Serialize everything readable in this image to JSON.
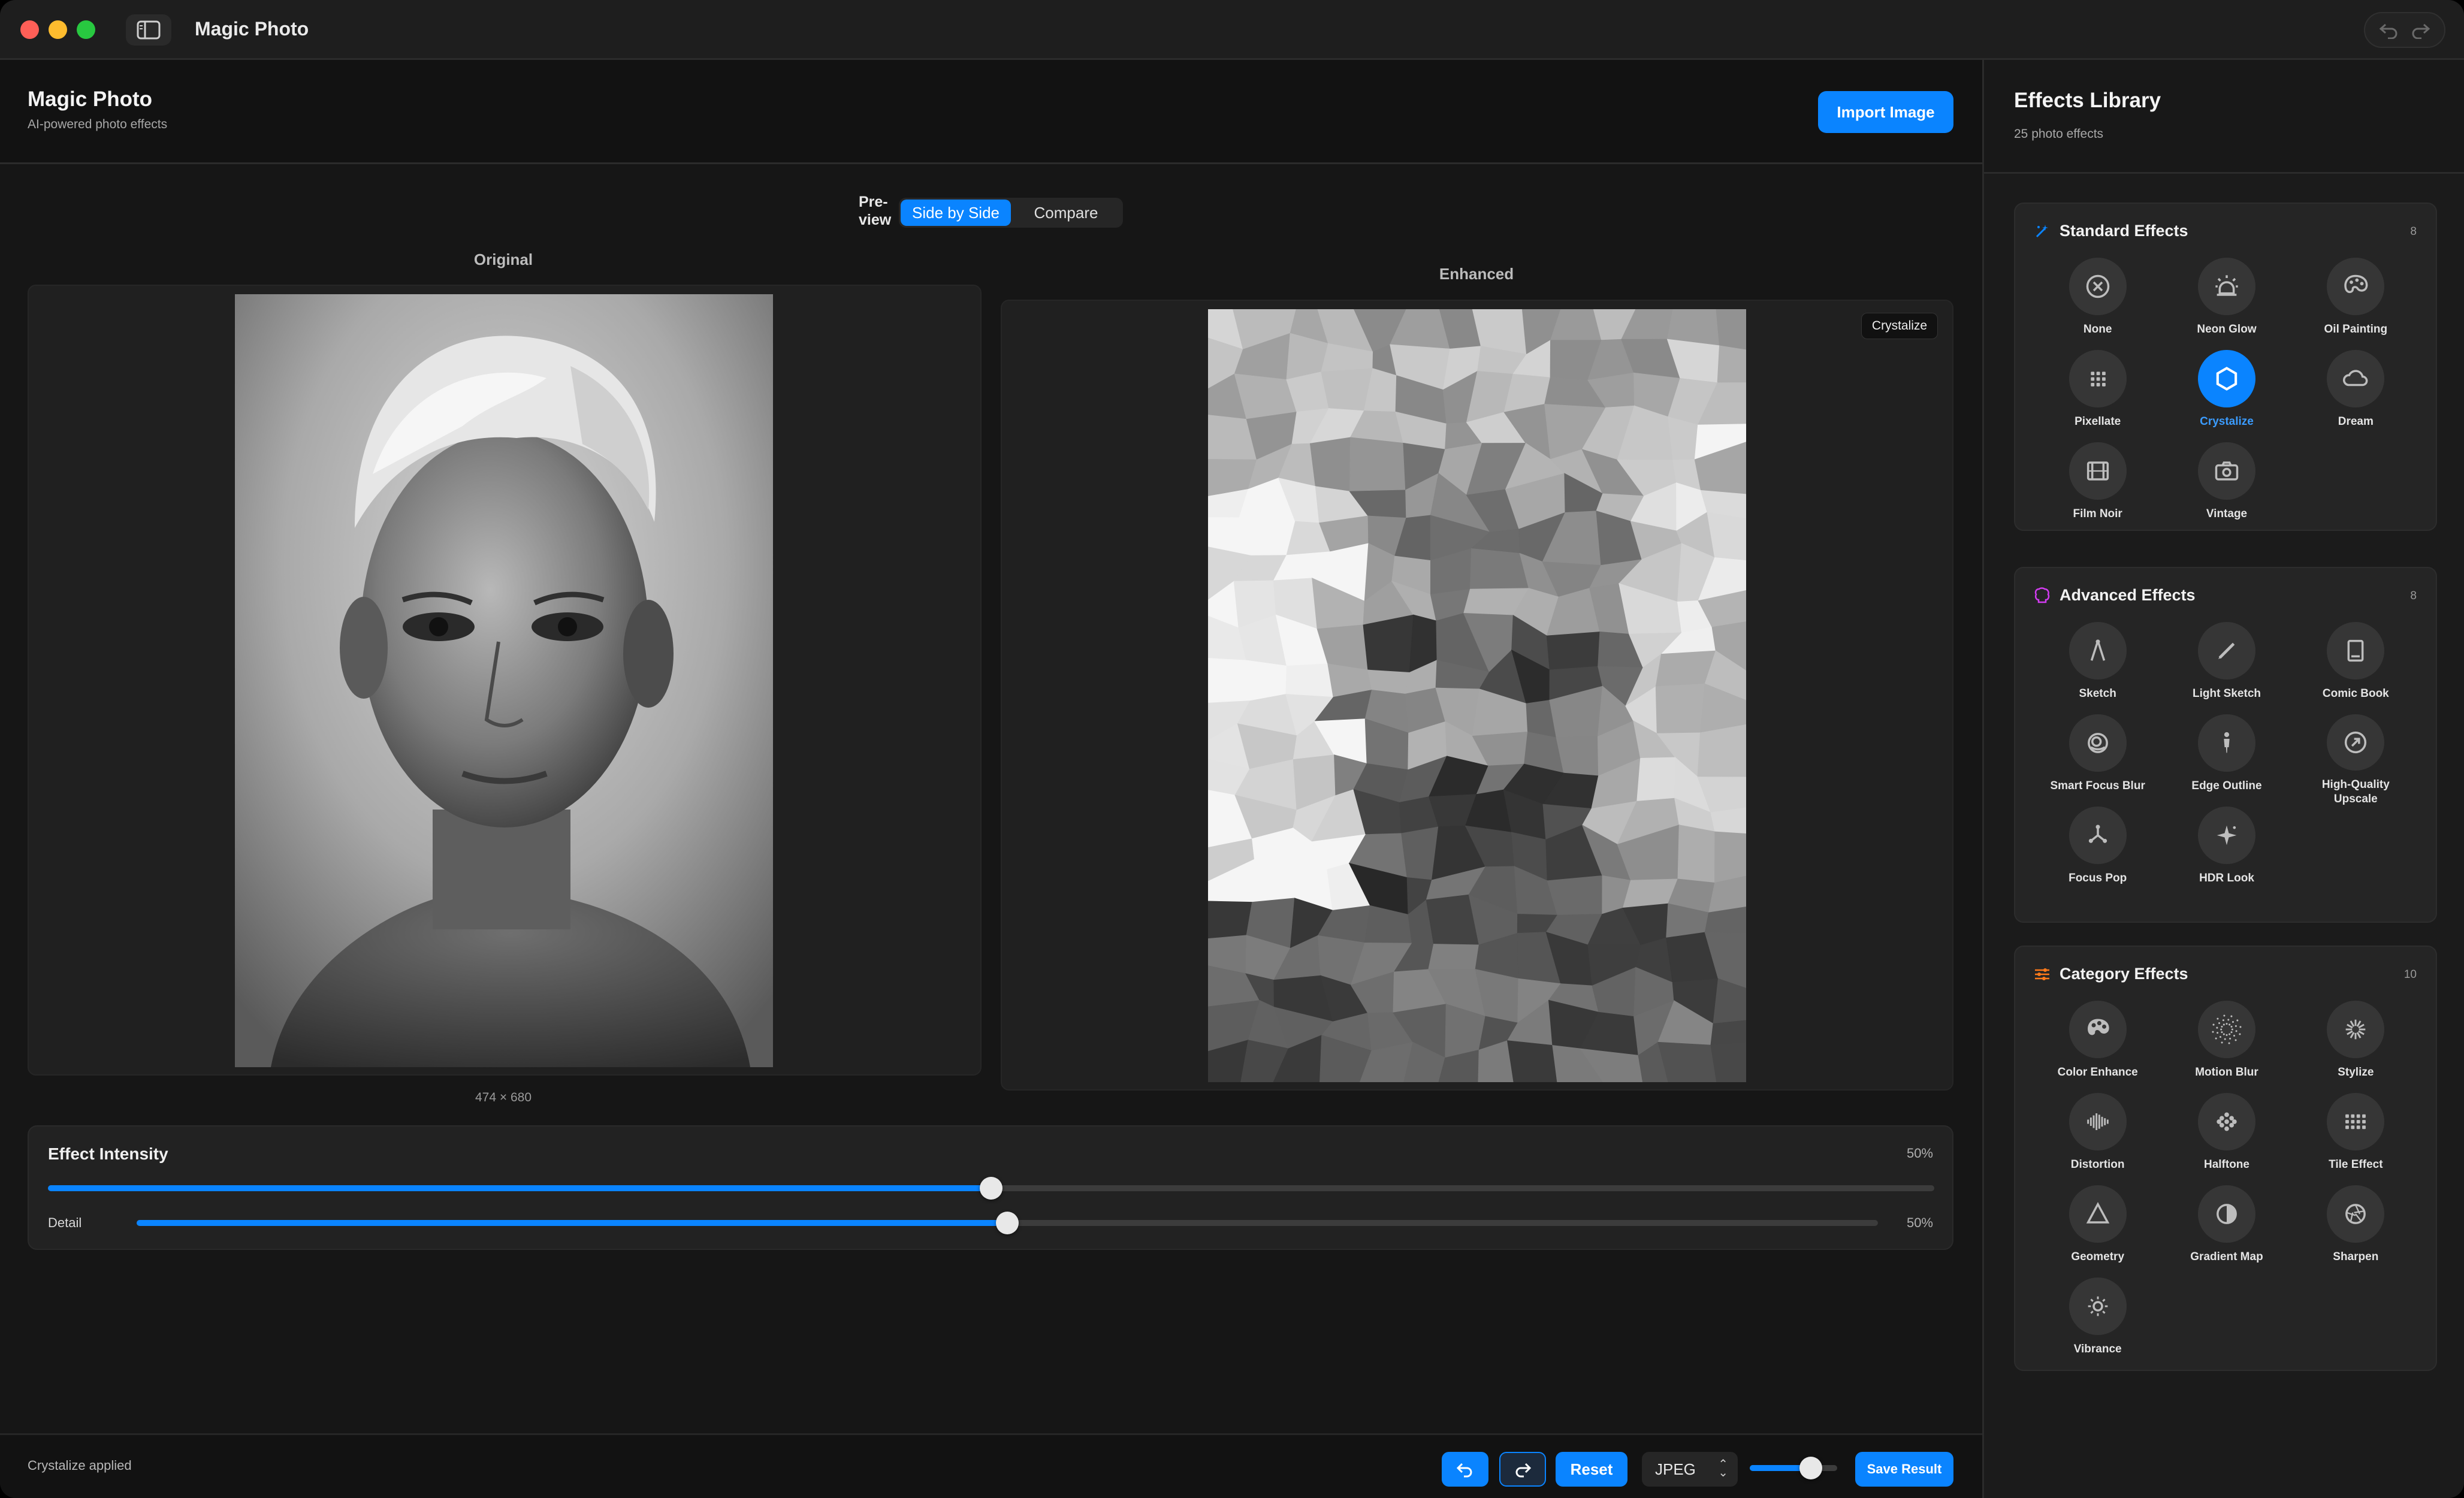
{
  "window": {
    "title": "Magic Photo",
    "traffic_lights": [
      "#ff5f57",
      "#febc2e",
      "#28c840"
    ]
  },
  "header": {
    "title": "Magic Photo",
    "subtitle": "AI-powered photo effects",
    "import_label": "Import Image"
  },
  "preview": {
    "label": "Pre-\nview",
    "modes": [
      "Side by Side",
      "Compare"
    ],
    "active_mode": "Side by Side",
    "original_label": "Original",
    "enhanced_label": "Enhanced",
    "dimensions": "474 × 680",
    "effect_tag": "Crystalize"
  },
  "intensity": {
    "title": "Effect Intensity",
    "value_label": "50%",
    "value": 0.5,
    "detail_label": "Detail",
    "detail_value_label": "50%",
    "detail_value": 0.5
  },
  "footer": {
    "status": "Crystalize applied",
    "reset_label": "Reset",
    "format": "JPEG",
    "quality": 0.7,
    "save_label": "Save Result"
  },
  "library": {
    "title": "Effects Library",
    "subtitle": "25 photo effects",
    "sections": [
      {
        "title": "Standard Effects",
        "count": "8",
        "icon": "sparkle-icon",
        "color": "#0a84ff",
        "effects": [
          {
            "label": "None",
            "icon": "none-icon"
          },
          {
            "label": "Neon Glow",
            "icon": "neon-glow-icon"
          },
          {
            "label": "Oil Painting",
            "icon": "palette-icon"
          },
          {
            "label": "Pixellate",
            "icon": "pixel-grid-icon"
          },
          {
            "label": "Crystalize",
            "icon": "hexagon-icon",
            "active": true
          },
          {
            "label": "Dream",
            "icon": "cloud-icon"
          },
          {
            "label": "Film Noir",
            "icon": "film-icon"
          },
          {
            "label": "Vintage",
            "icon": "camera-icon"
          }
        ]
      },
      {
        "title": "Advanced Effects",
        "count": "8",
        "icon": "brain-icon",
        "color": "#d23cf0",
        "effects": [
          {
            "label": "Sketch",
            "icon": "compass-icon"
          },
          {
            "label": "Light Sketch",
            "icon": "pencil-icon"
          },
          {
            "label": "Comic Book",
            "icon": "book-icon"
          },
          {
            "label": "Smart Focus Blur",
            "icon": "focus-blur-icon"
          },
          {
            "label": "Edge Outline",
            "icon": "figure-icon"
          },
          {
            "label": "High-Quality Upscale",
            "icon": "upscale-icon"
          },
          {
            "label": "Focus Pop",
            "icon": "focus-pop-icon"
          },
          {
            "label": "HDR Look",
            "icon": "sparkles-icon"
          }
        ]
      },
      {
        "title": "Category Effects",
        "count": "10",
        "icon": "sliders-icon",
        "color": "#ff7a1a",
        "effects": [
          {
            "label": "Color Enhance",
            "icon": "palette-fill-icon"
          },
          {
            "label": "Motion Blur",
            "icon": "dots-circle-icon"
          },
          {
            "label": "Stylize",
            "icon": "burst-icon"
          },
          {
            "label": "Distortion",
            "icon": "waveform-icon"
          },
          {
            "label": "Halftone",
            "icon": "halftone-icon"
          },
          {
            "label": "Tile Effect",
            "icon": "tile-grid-icon"
          },
          {
            "label": "Geometry",
            "icon": "triangle-icon"
          },
          {
            "label": "Gradient Map",
            "icon": "half-circle-icon"
          },
          {
            "label": "Sharpen",
            "icon": "aperture-icon"
          },
          {
            "label": "Vibrance",
            "icon": "sun-icon"
          }
        ]
      }
    ]
  }
}
